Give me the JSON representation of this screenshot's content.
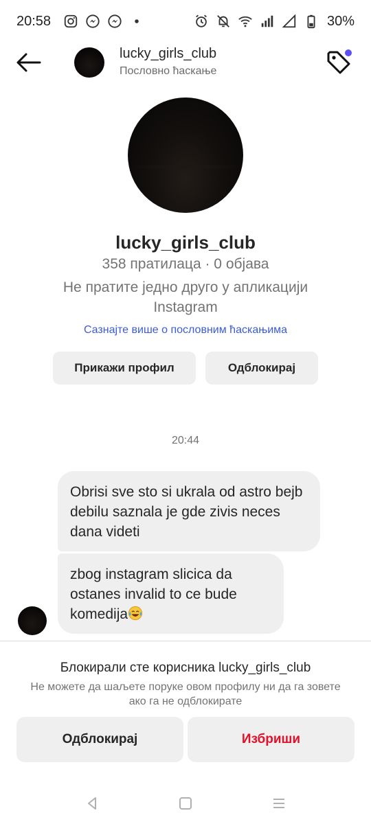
{
  "status_bar": {
    "time": "20:58",
    "battery_percent": "30%",
    "left_icons": [
      "instagram-icon",
      "messenger-icon",
      "messenger-icon",
      "dot-icon"
    ],
    "right_icons": [
      "alarm-icon",
      "mute-icon",
      "wifi-icon",
      "signal-icon",
      "signal-empty-icon",
      "battery-icon"
    ]
  },
  "header": {
    "username": "lucky_girls_club",
    "subtitle": "Пословно ћаскање",
    "notification_dot_color": "#5b51f5"
  },
  "profile": {
    "username": "lucky_girls_club",
    "stats": "358 пратилаца · 0 објава",
    "follow_status": "Не пратите једно друго у апликацији Instagram",
    "learn_more_link": "Сазнајте више о пословним ћаскањима",
    "view_profile_label": "Прикажи профил",
    "unblock_label": "Одблокирај"
  },
  "conversation": {
    "timestamp": "20:44",
    "messages": [
      {
        "text": "Obrisi sve sto si ukrala od astro bejb debilu saznala je gde zivis neces dana videti"
      },
      {
        "text": "zbog instagram slicica da ostanes invalid to ce bude komedija",
        "emoji": "face-with-tears-of-joy"
      }
    ]
  },
  "blocked_panel": {
    "title": "Блокирали сте корисника lucky_girls_club",
    "description": "Не можете да шаљете поруке овом профилу ни да га зовете ако га не одблокирате",
    "unblock_label": "Одблокирај",
    "delete_label": "Избриши",
    "delete_color": "#e0122a"
  },
  "colors": {
    "link": "#3b5bdb",
    "bubble_bg": "#efefef",
    "secondary_text": "#737373"
  }
}
